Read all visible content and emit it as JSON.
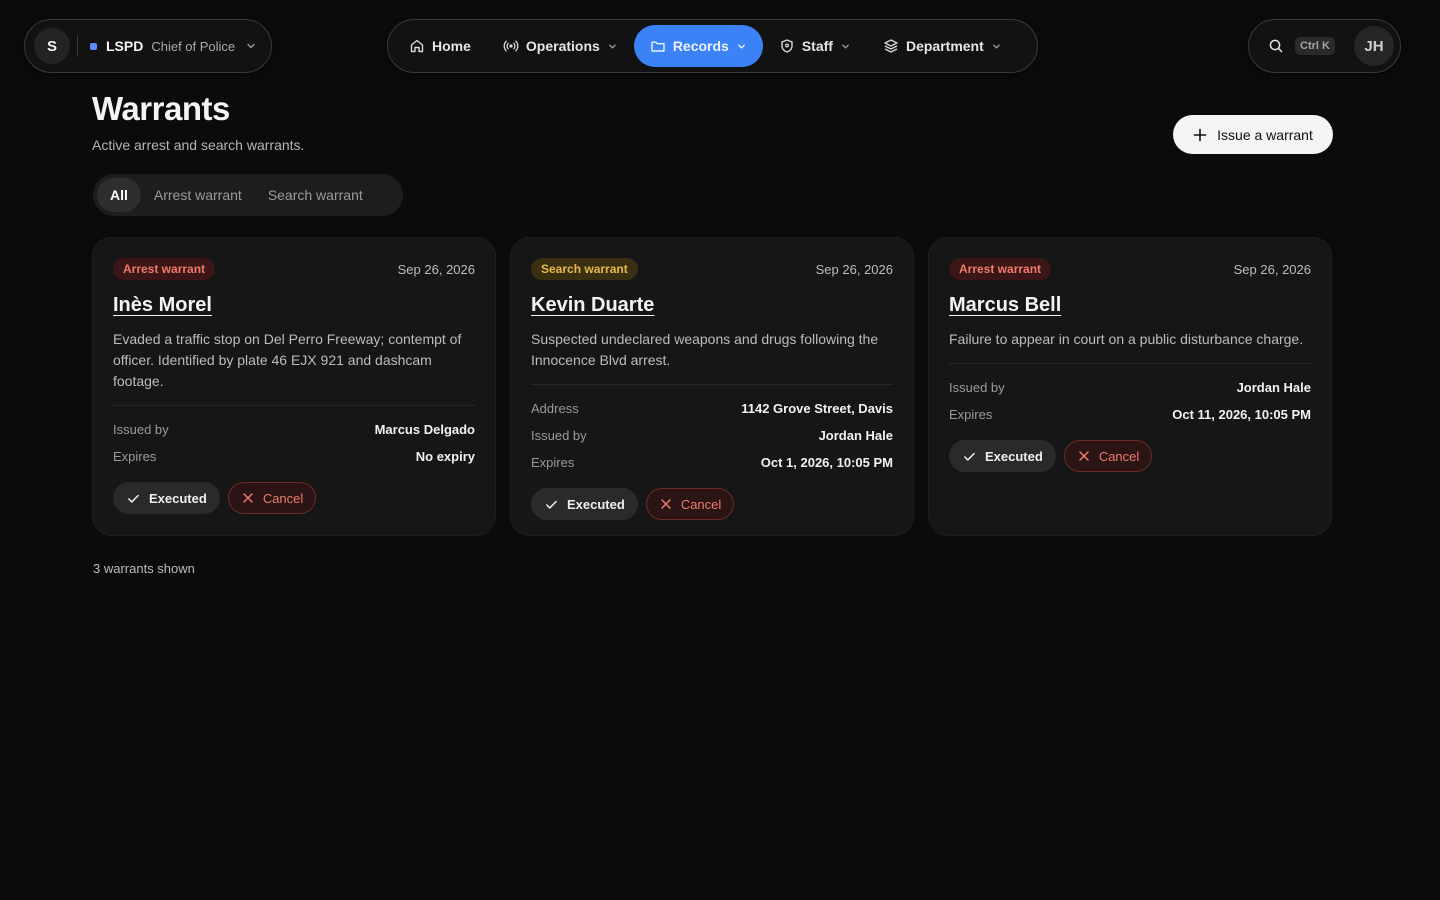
{
  "org": {
    "avatar_letter": "S",
    "name": "LSPD",
    "role": "Chief of Police",
    "accent": "#5b8cff"
  },
  "nav": {
    "items": [
      {
        "label": "Home",
        "icon": "home-icon",
        "has_dropdown": false,
        "active": false
      },
      {
        "label": "Operations",
        "icon": "broadcast-icon",
        "has_dropdown": true,
        "active": false
      },
      {
        "label": "Records",
        "icon": "folder-icon",
        "has_dropdown": true,
        "active": true
      },
      {
        "label": "Staff",
        "icon": "shield-icon",
        "has_dropdown": true,
        "active": false
      },
      {
        "label": "Department",
        "icon": "layers-icon",
        "has_dropdown": true,
        "active": false
      }
    ],
    "active_color": "#3b82f6"
  },
  "search": {
    "icon": "search-icon",
    "shortcut": "Ctrl K"
  },
  "user": {
    "initials": "JH"
  },
  "header": {
    "title": "Warrants",
    "subtitle": "Active arrest and search warrants.",
    "issue_button": "Issue a warrant"
  },
  "filters": {
    "items": [
      "All",
      "Arrest warrant",
      "Search warrant"
    ],
    "selected": "All"
  },
  "cards": [
    {
      "type": "Arrest warrant",
      "date": "Sep 26, 2026",
      "name": "Inès Morel",
      "description": "Evaded a traffic stop on Del Perro Freeway; contempt of officer. Identified by plate 46 EJX 921 and dashcam footage.",
      "fields": [
        {
          "key": "Issued by",
          "value": "Marcus Delgado"
        },
        {
          "key": "Expires",
          "value": "No expiry"
        }
      ],
      "executed_label": "Executed",
      "cancel_label": "Cancel"
    },
    {
      "type": "Search warrant",
      "date": "Sep 26, 2026",
      "name": "Kevin Duarte",
      "description": "Suspected undeclared weapons and drugs following the Innocence Blvd arrest.",
      "fields": [
        {
          "key": "Address",
          "value": "1142 Grove Street, Davis"
        },
        {
          "key": "Issued by",
          "value": "Jordan Hale"
        },
        {
          "key": "Expires",
          "value": "Oct 1, 2026, 10:05 PM"
        }
      ],
      "executed_label": "Executed",
      "cancel_label": "Cancel"
    },
    {
      "type": "Arrest warrant",
      "date": "Sep 26, 2026",
      "name": "Marcus Bell",
      "description": "Failure to appear in court on a public disturbance charge.",
      "fields": [
        {
          "key": "Issued by",
          "value": "Jordan Hale"
        },
        {
          "key": "Expires",
          "value": "Oct 11, 2026, 10:05 PM"
        }
      ],
      "executed_label": "Executed",
      "cancel_label": "Cancel"
    }
  ],
  "footer": {
    "count_text": "3 warrants shown"
  },
  "colors": {
    "background": "#0b0b0b",
    "card": "#161616",
    "arrest_badge": "#f07b6d",
    "search_badge": "#e9b84a",
    "cancel": "#ef7a6d"
  }
}
